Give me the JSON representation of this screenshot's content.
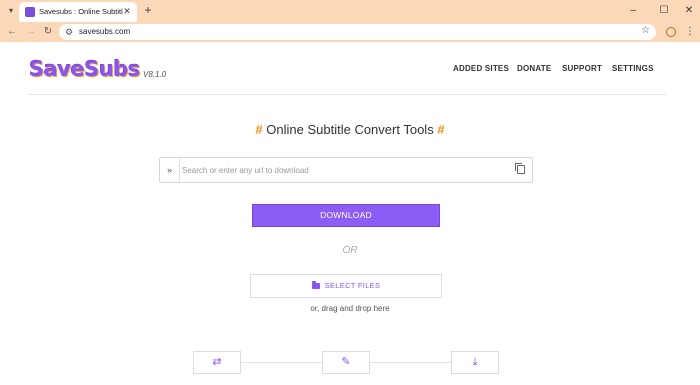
{
  "browser": {
    "tab_title": "Savesubs : Online Subtitle Conv",
    "url": "savesubs.com"
  },
  "site": {
    "logo": "SaveSubs",
    "version": "V8.1.0",
    "nav": [
      "ADDED SITES",
      "DONATE",
      "SUPPORT",
      "SETTINGS"
    ]
  },
  "main": {
    "headline_hash": "#",
    "headline": "Online Subtitle Convert Tools",
    "search_placeholder": "Search or enter any url to download",
    "download_label": "DOWNLOAD",
    "or_label": "OR",
    "select_files_label": "SELECT FILES",
    "drag_text": "or, drag and drop here"
  },
  "icons": {
    "steps": [
      "convert-icon",
      "edit-icon",
      "download-icon"
    ]
  },
  "colors": {
    "accent": "#8c5cf5",
    "hash": "#f08c1e",
    "chrome": "#fbd9b8"
  }
}
